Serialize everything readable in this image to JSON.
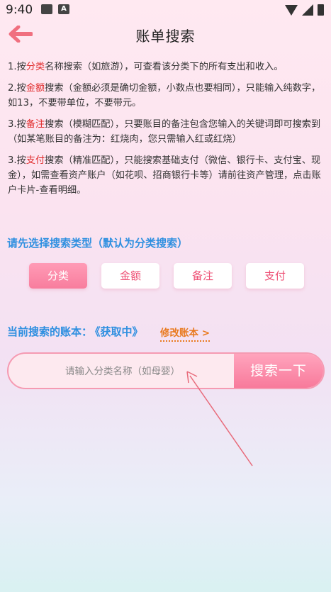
{
  "status_bar": {
    "time": "9:40",
    "icon_image": "image-icon",
    "icon_a": "A"
  },
  "header": {
    "title": "账单搜索",
    "back_icon": "arrow-left-icon"
  },
  "instructions": {
    "p1": {
      "pre": "1.按",
      "hl": "分类",
      "post": "名称搜索（如旅游），可查看该分类下的所有支出和收入。"
    },
    "p2": {
      "pre": "2.按",
      "hl": "金额",
      "post": "搜索（金额必须是确切金额，小数点也要相同），只能输入纯数字，如13，不要带单位，不要带元。"
    },
    "p3": {
      "pre": "3.按",
      "hl": "备注",
      "post": "搜索（模糊匹配），只要账目的备注包含您输入的关键词即可搜索到（如某笔账目的备注为：红烧肉，您只需输入红或红烧）"
    },
    "p4": {
      "pre": "3.按",
      "hl": "支付",
      "post": "搜索（精准匹配），只能搜索基础支付（微信、银行卡、支付宝、现金），如需查看资产账户（如花呗、招商银行卡等）请前往资产管理，点击账户卡片-查看明细。"
    }
  },
  "select_label": "请先选择搜索类型（默认为分类搜索）",
  "type_buttons": [
    {
      "label": "分类",
      "active": true
    },
    {
      "label": "金额",
      "active": false
    },
    {
      "label": "备注",
      "active": false
    },
    {
      "label": "支付",
      "active": false
    }
  ],
  "ledger": {
    "label": "当前搜索的账本：",
    "value": "《获取中》",
    "modify": "修改账本 >"
  },
  "search": {
    "placeholder": "请输入分类名称（如母婴）",
    "value": "",
    "button": "搜索一下"
  },
  "colors": {
    "accent_pink": "#f87d9d",
    "label_blue": "#2e8fe0",
    "highlight_red": "#e02a2a",
    "link_orange": "#e97a1f"
  }
}
